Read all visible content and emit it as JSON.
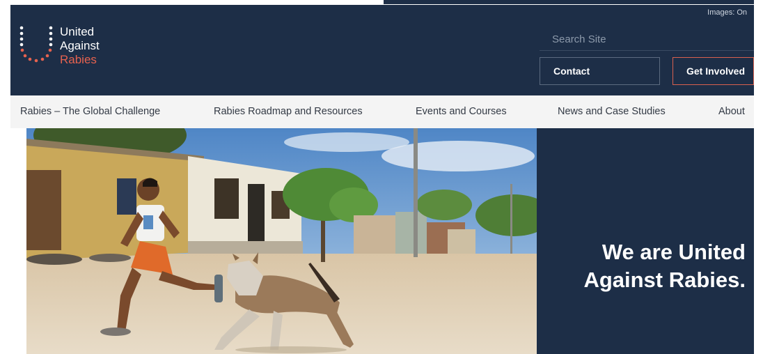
{
  "header": {
    "logo": {
      "line1": "United",
      "line2": "Against",
      "line3": "Rabies"
    },
    "images_toggle": "Images: On",
    "search_placeholder": "Search Site",
    "contact_label": "Contact",
    "get_involved_label": "Get Involved"
  },
  "nav": {
    "items": [
      {
        "label": "Rabies – The Global Challenge"
      },
      {
        "label": "Rabies Roadmap and Resources"
      },
      {
        "label": "Events and Courses"
      },
      {
        "label": "News and Case Studies"
      },
      {
        "label": "About"
      }
    ]
  },
  "hero": {
    "tagline_line1": "We are United",
    "tagline_line2": "Against Rabies."
  },
  "colors": {
    "navy": "#1d2e47",
    "accent": "#e6624f",
    "nav_bg": "#f4f4f4"
  }
}
